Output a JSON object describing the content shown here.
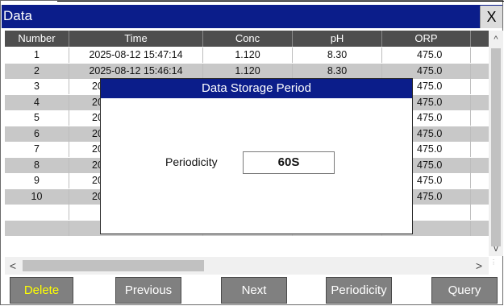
{
  "window": {
    "title": "Data",
    "close_label": "X"
  },
  "table": {
    "columns": [
      "Number",
      "Time",
      "Conc",
      "pH",
      "ORP"
    ],
    "rows": [
      [
        "1",
        "2025-08-12 15:47:14",
        "1.120",
        "8.30",
        "475.0"
      ],
      [
        "2",
        "2025-08-12 15:46:14",
        "1.120",
        "8.30",
        "475.0"
      ],
      [
        "3",
        "20",
        "",
        "",
        "475.0"
      ],
      [
        "4",
        "20",
        "",
        "",
        "475.0"
      ],
      [
        "5",
        "20",
        "",
        "",
        "475.0"
      ],
      [
        "6",
        "20",
        "",
        "",
        "475.0"
      ],
      [
        "7",
        "20",
        "",
        "",
        "475.0"
      ],
      [
        "8",
        "20",
        "",
        "",
        "475.0"
      ],
      [
        "9",
        "20",
        "",
        "",
        "475.0"
      ],
      [
        "10",
        "20",
        "",
        "",
        "475.0"
      ],
      [
        "",
        "",
        "",
        "",
        ""
      ],
      [
        "",
        "",
        "",
        "",
        ""
      ]
    ]
  },
  "scroll": {
    "up": "^",
    "down": "v",
    "left": "<",
    "right": ">"
  },
  "buttons": {
    "delete": "Delete",
    "previous": "Previous",
    "next": "Next",
    "periodicity": "Periodicity",
    "query": "Query"
  },
  "dialog": {
    "title": "Data Storage Period",
    "label": "Periodicity",
    "value": "60S"
  },
  "colors": {
    "title_bar": "#0b1d8a",
    "header": "#4e4e4e",
    "button": "#808080",
    "delete_text": "#ffff00"
  }
}
